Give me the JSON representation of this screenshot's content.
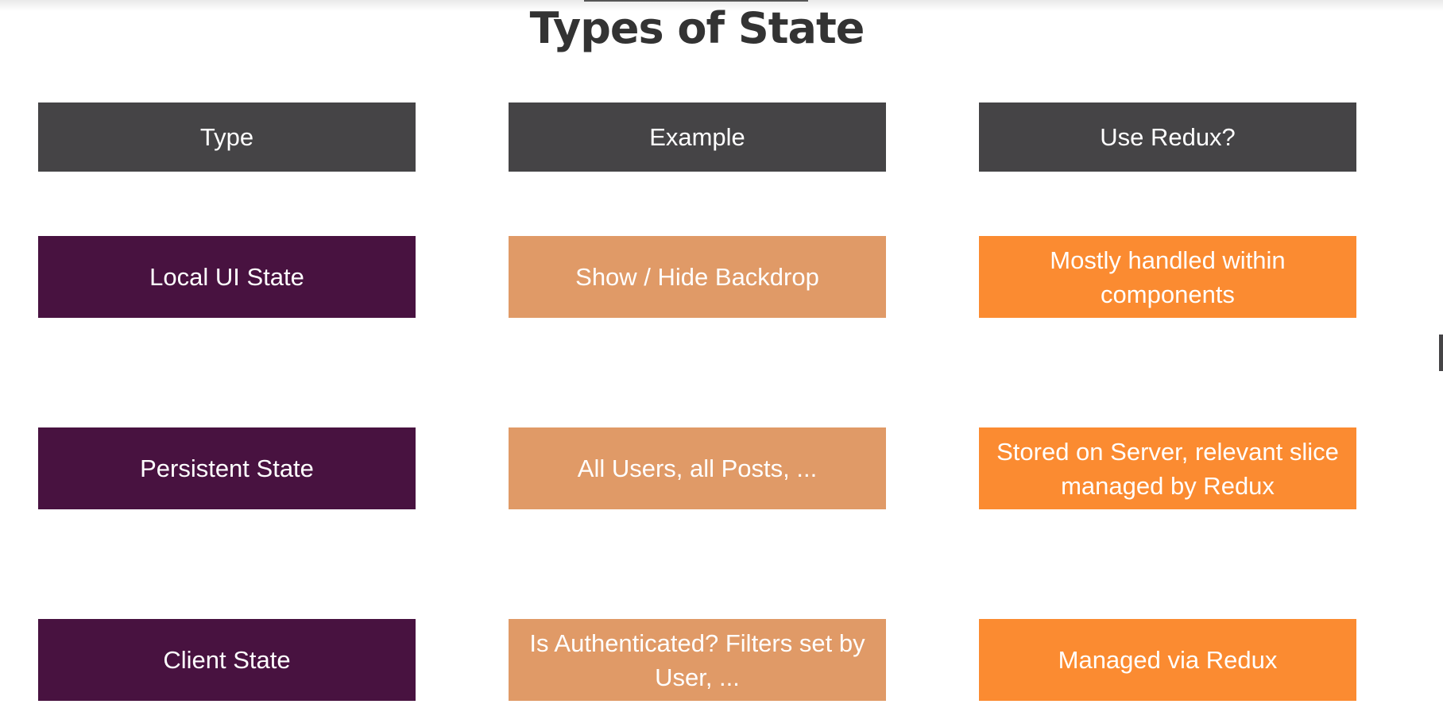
{
  "title": "Types of State",
  "headers": {
    "type": "Type",
    "example": "Example",
    "use_redux": "Use Redux?"
  },
  "rows": [
    {
      "type": "Local UI State",
      "example": "Show / Hide Backdrop",
      "use_redux": "Mostly handled within components"
    },
    {
      "type": "Persistent State",
      "example": "All Users, all Posts, ...",
      "use_redux": "Stored on Server, relevant slice managed by Redux"
    },
    {
      "type": "Client State",
      "example": "Is Authenticated? Filters set by User, ...",
      "use_redux": "Managed via Redux"
    }
  ],
  "colors": {
    "header": "#454446",
    "type": "#481240",
    "example": "#e09a67",
    "use_redux": "#fb8b31",
    "title": "#333333"
  }
}
